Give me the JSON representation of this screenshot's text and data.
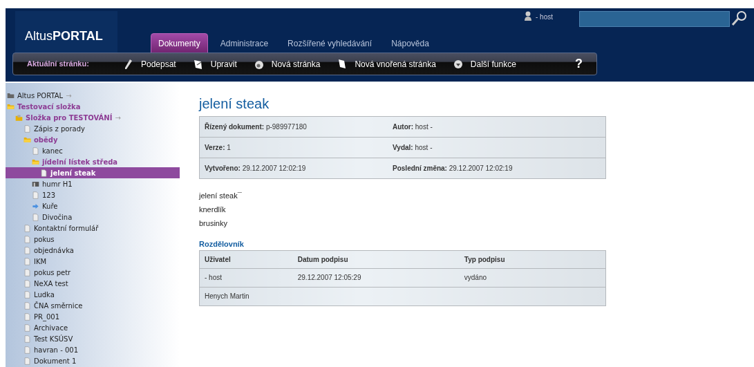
{
  "header": {
    "logo": {
      "light": "Altus",
      "bold": "PORTAL"
    },
    "user": "- host"
  },
  "tabs": [
    {
      "label": "Dokumenty",
      "selected": true
    },
    {
      "label": "Administrace",
      "selected": false
    },
    {
      "label": "Rozšířené vyhledávání",
      "selected": false
    },
    {
      "label": "Nápověda",
      "selected": false
    }
  ],
  "toolbar": {
    "label": "Aktuální stránku:",
    "actions": [
      {
        "label": "Podepsat"
      },
      {
        "label": "Upravit"
      },
      {
        "label": "Nová stránka"
      },
      {
        "label": "Nová vnořená stránka"
      },
      {
        "label": "Další funkce"
      }
    ],
    "help": "?"
  },
  "tree": [
    {
      "label": "Altus PORTAL",
      "suffix": "→",
      "kind": "root",
      "active": false,
      "selected": false
    },
    {
      "label": "Testovací složka",
      "kind": "folder",
      "active": true,
      "selected": false,
      "children": [
        {
          "label": "Složka pro TESTOVÁNÍ",
          "suffix": "→",
          "kind": "shared-folder",
          "active": true,
          "selected": false,
          "children": [
            {
              "label": "Zápis z porady",
              "kind": "doc",
              "active": false,
              "selected": false
            },
            {
              "label": "obědy",
              "kind": "folder",
              "active": true,
              "selected": false,
              "children": [
                {
                  "label": "kanec",
                  "kind": "doc",
                  "active": false,
                  "selected": false
                },
                {
                  "label": "jídelní lístek středa",
                  "kind": "folder",
                  "active": true,
                  "selected": false,
                  "children": [
                    {
                      "label": "jelení steak",
                      "kind": "doc",
                      "selected": true
                    }
                  ]
                },
                {
                  "label": "humr H1",
                  "kind": "bundle",
                  "active": false,
                  "selected": false
                },
                {
                  "label": "123",
                  "kind": "doc",
                  "active": false,
                  "selected": false
                },
                {
                  "label": "Kuře",
                  "kind": "link",
                  "active": false,
                  "selected": false
                },
                {
                  "label": "Divočina",
                  "kind": "doc",
                  "active": false,
                  "selected": false
                }
              ]
            },
            {
              "label": "Kontaktní formulář",
              "kind": "doc",
              "active": false,
              "selected": false
            },
            {
              "label": "pokus",
              "kind": "doc",
              "active": false,
              "selected": false
            },
            {
              "label": "objednávka",
              "kind": "doc",
              "active": false,
              "selected": false
            },
            {
              "label": "IKM",
              "kind": "doc",
              "active": false,
              "selected": false
            },
            {
              "label": "pokus petr",
              "kind": "doc",
              "active": false,
              "selected": false
            },
            {
              "label": "NeXA test",
              "kind": "doc",
              "active": false,
              "selected": false
            },
            {
              "label": "Ludka",
              "kind": "doc",
              "active": false,
              "selected": false
            },
            {
              "label": "ČNA směrnice",
              "kind": "doc",
              "active": false,
              "selected": false
            },
            {
              "label": "PR_001",
              "kind": "doc",
              "active": false,
              "selected": false
            },
            {
              "label": "Archivace",
              "kind": "doc",
              "active": false,
              "selected": false
            },
            {
              "label": "Test KSÚSV",
              "kind": "doc",
              "active": false,
              "selected": false
            },
            {
              "label": "havran - 001",
              "kind": "doc",
              "active": false,
              "selected": false
            },
            {
              "label": "Dokument 1",
              "kind": "doc",
              "active": false,
              "selected": false
            }
          ]
        }
      ]
    }
  ],
  "document": {
    "title": "jelení steak",
    "info": [
      [
        {
          "label": "Řízený dokument:",
          "value": "p-989977180"
        },
        {
          "label": "Autor:",
          "value": "host -"
        }
      ],
      [
        {
          "label": "Verze:",
          "value": "1"
        },
        {
          "label": "Vydal:",
          "value": "host -"
        }
      ],
      [
        {
          "label": "Vytvořeno:",
          "value": "29.12.2007 12:02:19"
        },
        {
          "label": "Poslední změna:",
          "value": "29.12.2007 12:02:19"
        }
      ]
    ],
    "body": [
      "jelení steak¯",
      "knerdlík",
      "brusinky"
    ],
    "distribution": {
      "title": "Rozdělovník",
      "columns": [
        "Uživatel",
        "Datum podpisu",
        "Typ podpisu"
      ],
      "rows": [
        [
          "- host",
          "29.12.2007 12:05:29",
          "vydáno"
        ],
        [
          "Henych Martin",
          "",
          ""
        ]
      ]
    }
  }
}
